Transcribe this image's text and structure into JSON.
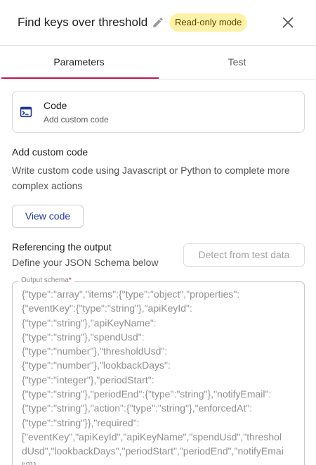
{
  "header": {
    "title": "Find keys over threshold",
    "badge": "Read-only mode"
  },
  "tabs": [
    {
      "label": "Parameters",
      "active": true
    },
    {
      "label": "Test",
      "active": false
    }
  ],
  "code_card": {
    "title": "Code",
    "subtitle": "Add custom code"
  },
  "custom_code": {
    "heading": "Add custom code",
    "description": "Write custom code using Javascript or Python to complete more complex actions",
    "view_button": "View code"
  },
  "output": {
    "heading": "Referencing the output",
    "description": "Define your JSON Schema below",
    "detect_button": "Detect from test data",
    "schema_label": "Output schema",
    "required_marker": "*",
    "schema_value": "{\"type\":\"array\",\"items\":{\"type\":\"object\",\"properties\":\n{\"eventKey\":{\"type\":\"string\"},\"apiKeyId\":\n{\"type\":\"string\"},\"apiKeyName\":\n{\"type\":\"string\"},\"spendUsd\":\n{\"type\":\"number\"},\"thresholdUsd\":\n{\"type\":\"number\"},\"lookbackDays\":\n{\"type\":\"integer\"},\"periodStart\":\n{\"type\":\"string\"},\"periodEnd\":{\"type\":\"string\"},\"notifyEmail\":\n{\"type\":\"string\"},\"action\":{\"type\":\"string\"},\"enforcedAt\":\n{\"type\":\"string\"}},\"required\":\n[\"eventKey\",\"apiKeyId\",\"apiKeyName\",\"spendUsd\",\"threshol\ndUsd\",\"lookbackDays\",\"periodStart\",\"periodEnd\",\"notifyEmai\nl\"]}}"
  },
  "colors": {
    "accent": "#c0184b",
    "badge_bg": "#fff2a8",
    "link": "#23399a",
    "code_icon": "#23399a"
  },
  "icons": {
    "edit": "pencil-icon",
    "close": "close-icon",
    "code": "terminal-icon"
  }
}
